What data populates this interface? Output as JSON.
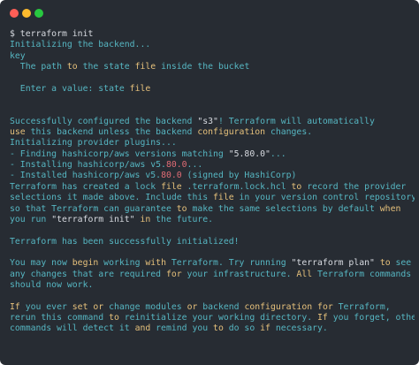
{
  "window": {
    "buttons": [
      "close",
      "minimize",
      "maximize"
    ]
  },
  "terminal": {
    "lines": [
      [
        {
          "t": "$ terraform init",
          "c": "cmd"
        }
      ],
      [
        {
          "t": "Initializing the backend...",
          "c": ""
        }
      ],
      [
        {
          "t": "key",
          "c": ""
        }
      ],
      [
        {
          "t": "  The path ",
          "c": ""
        },
        {
          "t": "to",
          "c": "kw"
        },
        {
          "t": " the state ",
          "c": ""
        },
        {
          "t": "file",
          "c": "kw"
        },
        {
          "t": " inside the bucket",
          "c": ""
        }
      ],
      [],
      [
        {
          "t": "  Enter a value: state ",
          "c": ""
        },
        {
          "t": "file",
          "c": "kw"
        }
      ],
      [],
      [],
      [
        {
          "t": "Successfully configured the backend ",
          "c": ""
        },
        {
          "t": "\"s3\"",
          "c": "str"
        },
        {
          "t": "! Terraform will automatically",
          "c": ""
        }
      ],
      [
        {
          "t": "use",
          "c": "kw"
        },
        {
          "t": " this backend unless the backend ",
          "c": ""
        },
        {
          "t": "configuration",
          "c": "kw"
        },
        {
          "t": " changes.",
          "c": ""
        }
      ],
      [
        {
          "t": "Initializing provider plugins...",
          "c": ""
        }
      ],
      [
        {
          "t": "- Finding hashicorp/aws versions matching ",
          "c": ""
        },
        {
          "t": "\"5.80.0\"",
          "c": "str"
        },
        {
          "t": "...",
          "c": ""
        }
      ],
      [
        {
          "t": "- Installing hashicorp/aws v5.",
          "c": ""
        },
        {
          "t": "80.0",
          "c": "ver"
        },
        {
          "t": "...",
          "c": ""
        }
      ],
      [
        {
          "t": "- Installed hashicorp/aws v5.",
          "c": ""
        },
        {
          "t": "80.0",
          "c": "ver"
        },
        {
          "t": " (signed by HashiCorp)",
          "c": ""
        }
      ],
      [
        {
          "t": "Terraform has created a lock ",
          "c": ""
        },
        {
          "t": "file",
          "c": "kw"
        },
        {
          "t": " .terraform.lock.hcl ",
          "c": ""
        },
        {
          "t": "to",
          "c": "kw"
        },
        {
          "t": " record the provider",
          "c": ""
        }
      ],
      [
        {
          "t": "selections it made above. Include this ",
          "c": ""
        },
        {
          "t": "file",
          "c": "kw"
        },
        {
          "t": " in your version control repository",
          "c": ""
        }
      ],
      [
        {
          "t": "so that Terraform can guarantee ",
          "c": ""
        },
        {
          "t": "to",
          "c": "kw"
        },
        {
          "t": " make the same selections by default ",
          "c": ""
        },
        {
          "t": "when",
          "c": "kw"
        }
      ],
      [
        {
          "t": "you run ",
          "c": ""
        },
        {
          "t": "\"terraform init\"",
          "c": "str"
        },
        {
          "t": " ",
          "c": ""
        },
        {
          "t": "in",
          "c": "kw"
        },
        {
          "t": " the future.",
          "c": ""
        }
      ],
      [],
      [
        {
          "t": "Terraform has been successfully initialized!",
          "c": ""
        }
      ],
      [],
      [
        {
          "t": "You may now ",
          "c": ""
        },
        {
          "t": "begin",
          "c": "kw"
        },
        {
          "t": " working ",
          "c": ""
        },
        {
          "t": "with",
          "c": "kw"
        },
        {
          "t": " Terraform. Try running ",
          "c": ""
        },
        {
          "t": "\"terraform plan\"",
          "c": "str"
        },
        {
          "t": " ",
          "c": ""
        },
        {
          "t": "to",
          "c": "kw"
        },
        {
          "t": " see",
          "c": ""
        }
      ],
      [
        {
          "t": "any changes that are required ",
          "c": ""
        },
        {
          "t": "for",
          "c": "kw"
        },
        {
          "t": " your infrastructure. ",
          "c": ""
        },
        {
          "t": "All",
          "c": "kw"
        },
        {
          "t": " Terraform commands",
          "c": ""
        }
      ],
      [
        {
          "t": "should now work.",
          "c": ""
        }
      ],
      [],
      [
        {
          "t": "If",
          "c": "kw"
        },
        {
          "t": " you ever ",
          "c": ""
        },
        {
          "t": "set",
          "c": "kw"
        },
        {
          "t": " ",
          "c": ""
        },
        {
          "t": "or",
          "c": "kw"
        },
        {
          "t": " change modules ",
          "c": ""
        },
        {
          "t": "or",
          "c": "kw"
        },
        {
          "t": " backend ",
          "c": ""
        },
        {
          "t": "configuration",
          "c": "kw"
        },
        {
          "t": " ",
          "c": ""
        },
        {
          "t": "for",
          "c": "kw"
        },
        {
          "t": " Terraform,",
          "c": ""
        }
      ],
      [
        {
          "t": "rerun this command ",
          "c": ""
        },
        {
          "t": "to",
          "c": "kw"
        },
        {
          "t": " reinitialize your working directory. ",
          "c": ""
        },
        {
          "t": "If",
          "c": "kw"
        },
        {
          "t": " you forget, other",
          "c": ""
        }
      ],
      [
        {
          "t": "commands will detect it ",
          "c": ""
        },
        {
          "t": "and",
          "c": "kw"
        },
        {
          "t": " remind you ",
          "c": ""
        },
        {
          "t": "to",
          "c": "kw"
        },
        {
          "t": " do so ",
          "c": ""
        },
        {
          "t": "if",
          "c": "kw"
        },
        {
          "t": " necessary.",
          "c": ""
        }
      ]
    ]
  }
}
